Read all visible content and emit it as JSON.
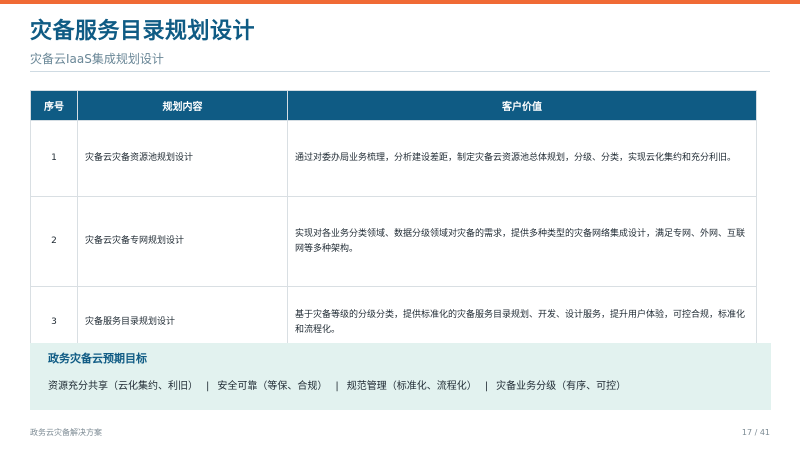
{
  "header": {
    "title": "灾备服务目录规划设计",
    "subtitle": "灾备云IaaS集成规划设计"
  },
  "table": {
    "columns": [
      "序号",
      "规划内容",
      "客户价值"
    ],
    "rows": [
      {
        "no": "1",
        "content": "灾备云灾备资源池规划设计",
        "value": "通过对委办局业务梳理，分析建设差距，制定灾备云资源池总体规划，分级、分类，实现云化集约和充分利旧。"
      },
      {
        "no": "2",
        "content": "灾备云灾备专网规划设计",
        "value": "实现对各业务分类领域、数据分级领域对灾备的需求，提供多种类型的灾备网络集成设计，满足专网、外网、互联网等多种架构。"
      },
      {
        "no": "3",
        "content": "灾备服务目录规划设计",
        "value": "基于灾备等级的分级分类，提供标准化的灾备服务目录规划、开发、设计服务，提升用户体验，可控合规，标准化和流程化。"
      }
    ]
  },
  "goals": {
    "title": "政务灾备云预期目标",
    "separator": "|",
    "items": [
      "资源充分共享（云化集约、利旧）",
      "安全可靠（等保、合规）",
      "规范管理（标准化、流程化）",
      "灾备业务分级（有序、可控）"
    ]
  },
  "footer": {
    "left": "政务云灾备解决方案",
    "page": "17 / 41"
  },
  "colors": {
    "accent_bar": "#f06a35",
    "title_blue": "#0f5b84",
    "header_fill": "#0f5b84",
    "goal_panel": "#e2f2ef"
  }
}
